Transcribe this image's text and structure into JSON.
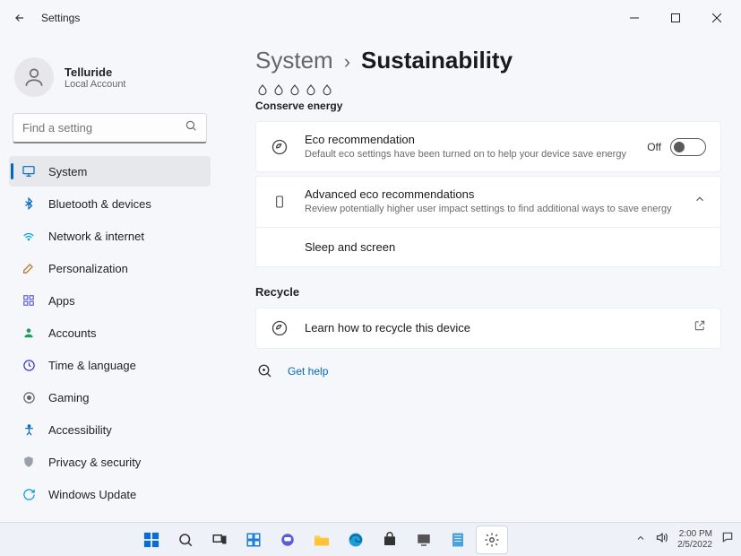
{
  "window": {
    "title": "Settings"
  },
  "user": {
    "name": "Telluride",
    "sub": "Local Account"
  },
  "search": {
    "placeholder": "Find a setting"
  },
  "nav": {
    "system": "System",
    "bluetooth": "Bluetooth & devices",
    "network": "Network & internet",
    "personalization": "Personalization",
    "apps": "Apps",
    "accounts": "Accounts",
    "time": "Time & language",
    "gaming": "Gaming",
    "accessibility": "Accessibility",
    "privacy": "Privacy & security",
    "update": "Windows Update"
  },
  "breadcrumb": {
    "parent": "System",
    "current": "Sustainability"
  },
  "sections": {
    "conserve": "Conserve energy",
    "recycle": "Recycle",
    "eco": {
      "title": "Eco recommendation",
      "sub": "Default eco settings have been turned on to help your device save energy",
      "toggle_label": "Off"
    },
    "advanced": {
      "title": "Advanced eco recommendations",
      "sub": "Review potentially higher user impact settings to find additional ways to save energy",
      "sleep": "Sleep and screen"
    },
    "learn": {
      "title": "Learn how to recycle this device"
    }
  },
  "help": {
    "label": "Get help"
  },
  "tray": {
    "time": "2:00 PM",
    "date": "2/5/2022"
  },
  "colors": {
    "accent": "#0067c0"
  }
}
